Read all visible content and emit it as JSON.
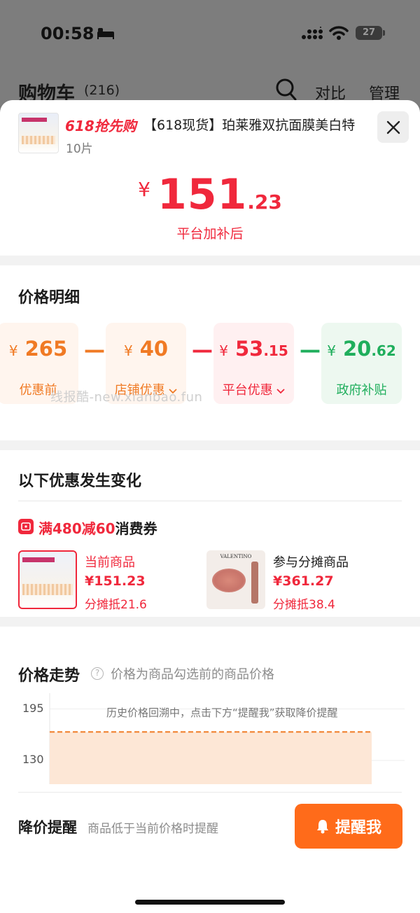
{
  "status_bar": {
    "time": "00:58",
    "battery": "27"
  },
  "cart": {
    "title": "购物车",
    "count": "(216)",
    "compare": "对比",
    "manage": "管理"
  },
  "product": {
    "promo_tag": "618抢先购",
    "name": "【618现货】珀莱雅双抗面膜美白特",
    "spec": "10片",
    "price": {
      "currency": "¥",
      "integer": "151",
      "decimal": ".23"
    },
    "price_note": "平台加补后"
  },
  "price_detail": {
    "title": "价格明细",
    "items": [
      {
        "currency": "¥",
        "integer": "265",
        "decimal": "",
        "label": "优惠前",
        "color": "#f07a24",
        "bg": "#fff5ee"
      },
      {
        "currency": "¥",
        "integer": "40",
        "decimal": "",
        "label": "店铺优惠",
        "color": "#f07a24",
        "bg": "#fff5ee"
      },
      {
        "currency": "¥",
        "integer": "53",
        "decimal": ".15",
        "label": "平台优惠",
        "color": "#f0283c",
        "bg": "#fff0f1"
      },
      {
        "currency": "¥",
        "integer": "20",
        "decimal": ".62",
        "label": "政府补贴",
        "color": "#1fae5c",
        "bg": "#edf8f0"
      }
    ],
    "operator": "—",
    "watermark": "线报酷-new.xianbao.fun"
  },
  "changes": {
    "title": "以下优惠发生变化",
    "coupon_amount": "满480减60",
    "coupon_suffix": "消费券",
    "current": {
      "label": "当前商品",
      "price": "¥151.23",
      "share": "分摊抵21.6"
    },
    "other": {
      "label": "参与分摊商品",
      "price": "¥361.27",
      "share": "分摊抵38.4",
      "brand": "VALENTINO"
    }
  },
  "trend": {
    "title": "价格走势",
    "help": "?",
    "subtitle": "价格为商品勾选前的商品价格",
    "note": "历史价格回溯中，点击下方“提醒我”获取降价提醒",
    "colors": {
      "line": "#f07a24",
      "fill": "#fde7d6"
    }
  },
  "chart_data": {
    "type": "area",
    "ylim": [
      100,
      215
    ],
    "y_ticks": [
      195,
      130
    ],
    "series": [
      {
        "values": [
          166,
          166
        ]
      }
    ]
  },
  "reminder": {
    "title": "降价提醒",
    "subtitle": "商品低于当前价格时提醒",
    "button": "提醒我"
  }
}
